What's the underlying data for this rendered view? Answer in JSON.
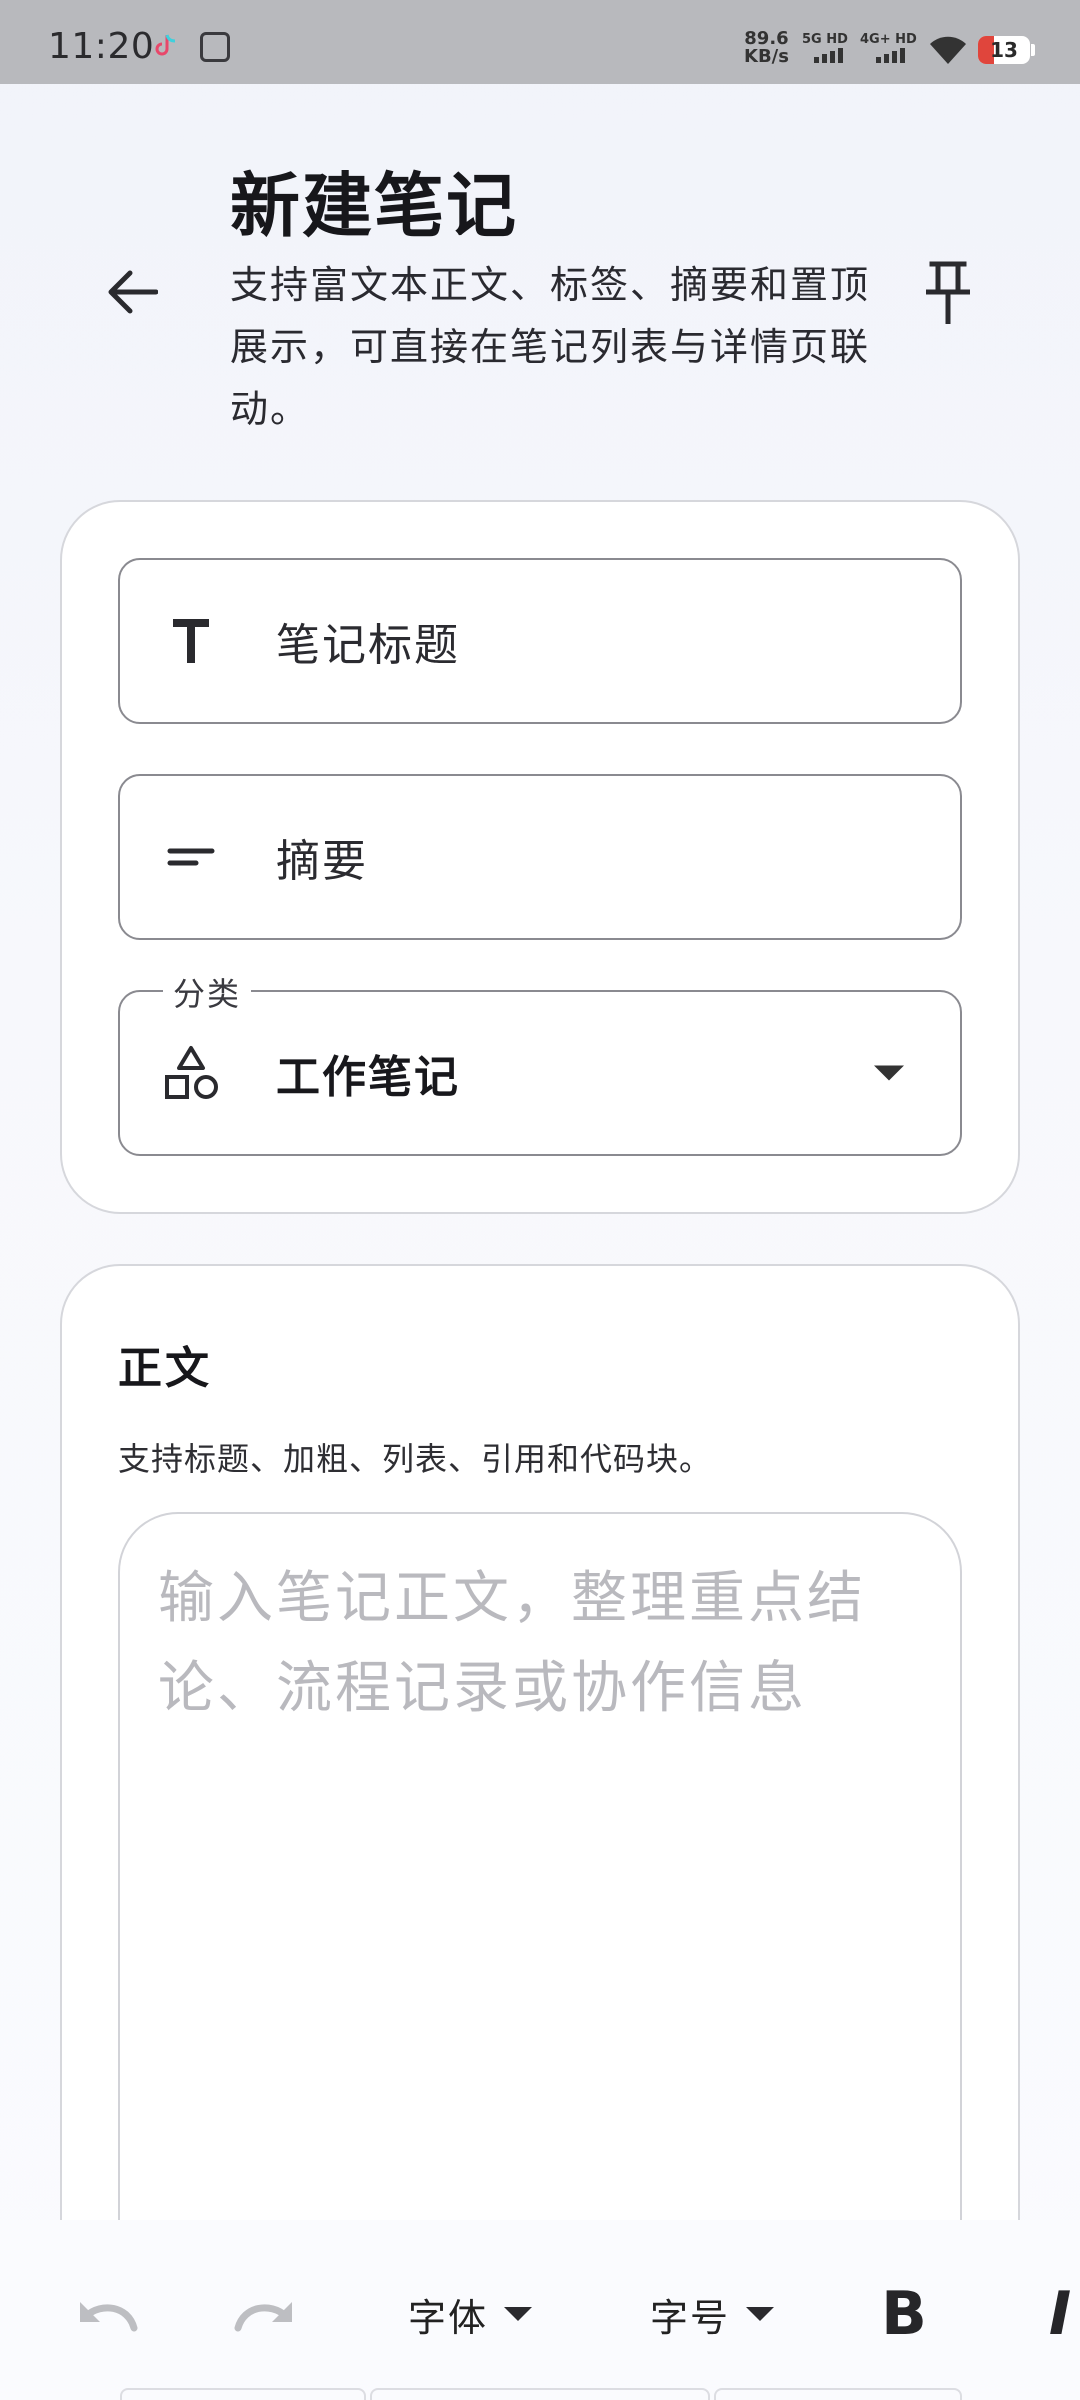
{
  "status_bar": {
    "time": "11:20",
    "net_speed_value": "89.6",
    "net_speed_unit": "KB/s",
    "sim1": "5G HD",
    "sim2": "4G+ HD",
    "battery": "13"
  },
  "header": {
    "title": "新建笔记",
    "subtitle": "支持富文本正文、标签、摘要和置顶展示，可直接在笔记列表与详情页联动。"
  },
  "form": {
    "title_placeholder": "笔记标题",
    "summary_placeholder": "摘要",
    "category_label": "分类",
    "category_value": "工作笔记"
  },
  "body_section": {
    "title": "正文",
    "hint": "支持标题、加粗、列表、引用和代码块。",
    "placeholder": "输入笔记正文，整理重点结论、流程记录或协作信息"
  },
  "toolbar": {
    "font_label": "字体",
    "size_label": "字号",
    "bold_label": "B",
    "italic_label": "I"
  },
  "icons": {
    "back": "arrow-left-icon",
    "pin": "pin-icon",
    "title_field": "text-t-icon",
    "summary_field": "short-text-icon",
    "category_field": "shapes-icon",
    "undo": "undo-icon",
    "redo": "redo-icon"
  }
}
